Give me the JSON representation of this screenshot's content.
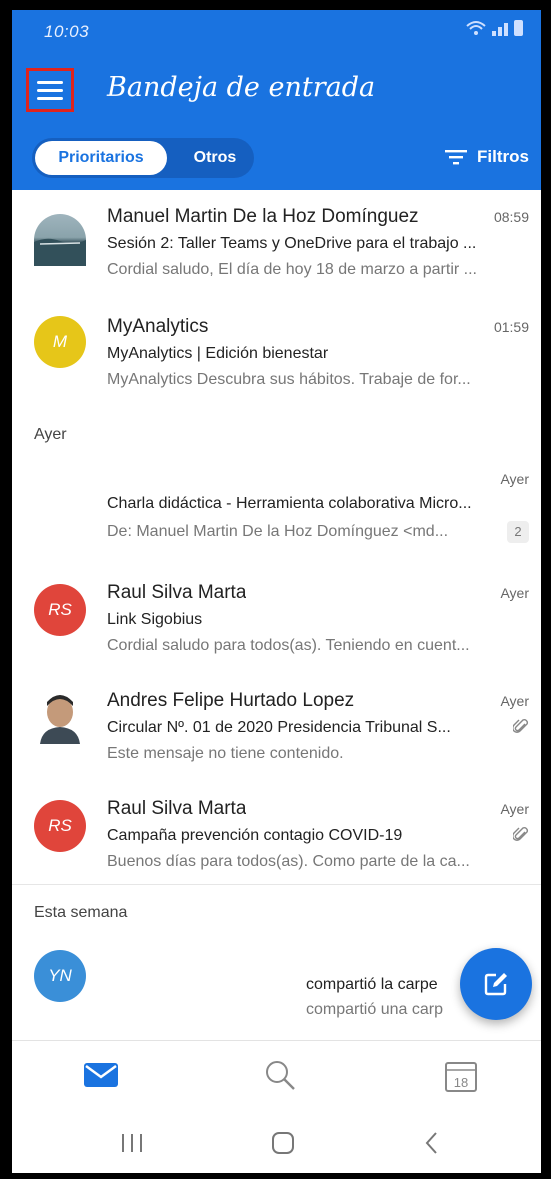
{
  "status_bar": {
    "time": "10:03"
  },
  "header": {
    "title": "Bandeja de entrada",
    "segments": [
      "Prioritarios",
      "Otros"
    ],
    "filters_label": "Filtros"
  },
  "emails": [
    {
      "sender": "Manuel Martin De la Hoz Domínguez",
      "time": "08:59",
      "subject": "Sesión 2: Taller Teams y OneDrive para el trabajo ...",
      "preview": "Cordial saludo, El día de hoy 18 de marzo a partir ...",
      "avatar": "landscape-photo"
    },
    {
      "sender": "MyAnalytics",
      "time": "01:59",
      "subject": "MyAnalytics | Edición bienestar",
      "preview": "MyAnalytics Descubra sus hábitos. Trabaje de for...",
      "avatar_initials": "M",
      "avatar_color": "#e6c619"
    }
  ],
  "section_yesterday": "Ayer",
  "emails_yesterday": [
    {
      "sender": "",
      "time": "Ayer",
      "subject": "Charla didáctica - Herramienta colaborativa Micro...",
      "preview": "De: Manuel Martin De la Hoz Domínguez <md...",
      "count": "2"
    },
    {
      "sender": "Raul Silva Marta",
      "time": "Ayer",
      "subject": "Link Sigobius",
      "preview": "Cordial saludo para todos(as). Teniendo en cuent...",
      "avatar_initials": "RS",
      "avatar_color": "#e0453b"
    },
    {
      "sender": "Andres Felipe Hurtado Lopez",
      "time": "Ayer",
      "subject": "Circular Nº. 01 de 2020 Presidencia Tribunal S...",
      "preview": "Este mensaje no tiene contenido.",
      "avatar": "person-photo",
      "attachment": true
    },
    {
      "sender": "Raul Silva Marta",
      "time": "Ayer",
      "subject": "Campaña prevención contagio COVID-19",
      "preview": "Buenos días para todos(as). Como parte de la ca...",
      "avatar_initials": "RS",
      "avatar_color": "#e0453b",
      "attachment": true
    }
  ],
  "section_week": "Esta semana",
  "email_week": {
    "avatar_initials": "YN",
    "avatar_color": "#3a8fd8",
    "subject": "compartió la carpe",
    "preview": "compartió una carp"
  },
  "colors": {
    "accent": "#1a73e0",
    "highlight": "#e0241c"
  }
}
